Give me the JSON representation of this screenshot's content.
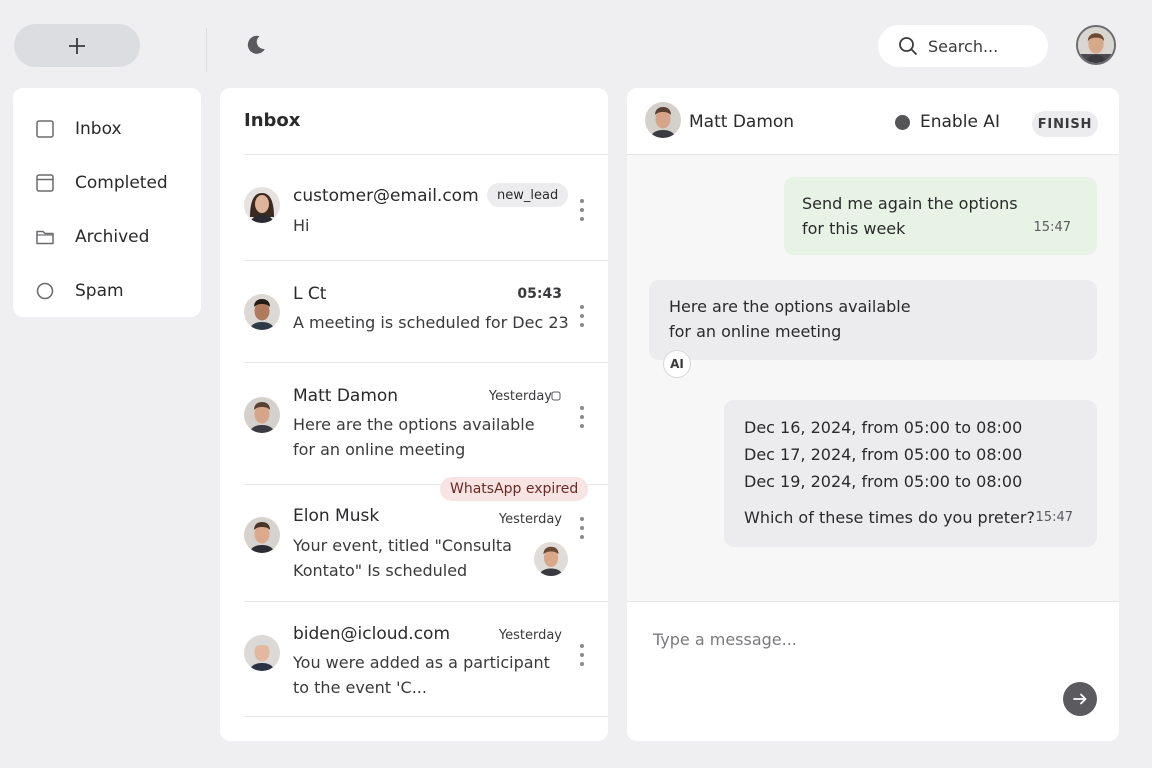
{
  "toolbar": {
    "new_icon": "plus-icon",
    "theme_icon": "moon-icon",
    "search_placeholder": "Search...",
    "search_icon": "search-icon"
  },
  "sidebar": {
    "items": [
      {
        "label": "Inbox",
        "icon": "square-checkbox-icon"
      },
      {
        "label": "Completed",
        "icon": "calendar-icon"
      },
      {
        "label": "Archived",
        "icon": "folder-icon"
      },
      {
        "label": "Spam",
        "icon": "circle-icon"
      }
    ]
  },
  "inbox": {
    "title": "Inbox",
    "conversations": [
      {
        "name": "customer@email.com",
        "snippet": "Hi",
        "time": "",
        "tag": "new_lead"
      },
      {
        "name": "L Ct",
        "snippet": "A meeting is scheduled for Dec 23",
        "time": "05:43"
      },
      {
        "name": "Matt Damon",
        "snippet1": "Here are the options available",
        "snippet2": "for an online meeting",
        "time": "Yesterday"
      },
      {
        "name": "Elon Musk",
        "snippet1": "Your event, titled \"Consulta",
        "snippet2": "Kontato\" Is scheduled",
        "time": "Yesterday",
        "tag": "WhatsApp expired"
      },
      {
        "name": "biden@icloud.com",
        "snippet1": "You were added as a participant",
        "snippet2": "to the event 'C...",
        "time": "Yesterday"
      }
    ]
  },
  "chat": {
    "contact_name": "Matt Damon",
    "ai_toggle_label": "Enable AI",
    "finish_label": "FINISH",
    "messages": {
      "out1": {
        "line1": "Send me again the options",
        "line2": "for this week",
        "time": "15:47"
      },
      "in1": {
        "line1": "Here are the options available",
        "line2": "for an online meeting",
        "badge": "AI"
      },
      "out2": {
        "lines": [
          "Dec 16, 2024, from 05:00 to 08:00",
          "Dec 17, 2024, from 05:00 to 08:00",
          "Dec 19, 2024, from 05:00 to 08:00"
        ],
        "question": "Which of these times do you preter?",
        "time": "15:47"
      }
    },
    "compose_placeholder": "Type a message...",
    "send_icon": "arrow-right-icon"
  },
  "colors": {
    "background": "#efeff1",
    "panel": "#ffffff",
    "outgoing_bubble": "#e7f3e4",
    "neutral_bubble": "#ececee",
    "expired_tag": "#f8e5e3",
    "send_button": "#5b5b5f"
  }
}
